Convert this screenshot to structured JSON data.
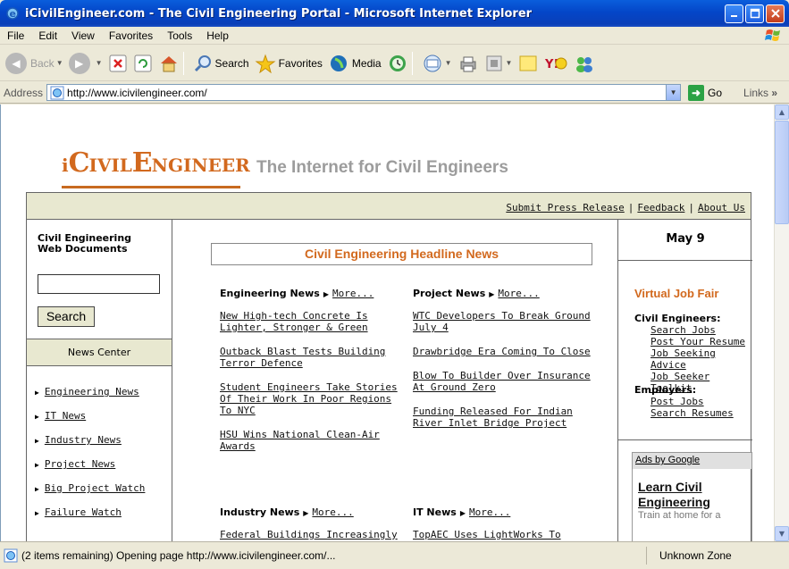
{
  "window": {
    "title": "iCivilEngineer.com - The Civil Engineering Portal - Microsoft Internet Explorer"
  },
  "menu": [
    "File",
    "Edit",
    "View",
    "Favorites",
    "Tools",
    "Help"
  ],
  "toolbar": {
    "back": "Back",
    "search": "Search",
    "favorites": "Favorites",
    "media": "Media"
  },
  "address": {
    "label": "Address",
    "url": "http://www.icivilengineer.com/",
    "go": "Go",
    "links": "Links"
  },
  "site": {
    "logo_first": "i",
    "logo_civil_c": "C",
    "logo_civil_rest": "IVIL",
    "logo_eng_e": "E",
    "logo_eng_rest": "NGINEER",
    "tagline": "The Internet for Civil Engineers",
    "nav": [
      "Submit Press Release",
      "Feedback",
      "About Us"
    ],
    "left": {
      "docs_title_1": "Civil Engineering",
      "docs_title_2": "Web Documents",
      "search_button": "Search",
      "news_center": "News Center",
      "news_links": [
        "Engineering News",
        "IT News",
        "Industry News",
        "Project News",
        "Big Project Watch",
        "Failure Watch"
      ]
    },
    "center": {
      "headline": "Civil Engineering Headline News",
      "more": "More...",
      "engineering": {
        "title": "Engineering News",
        "items": [
          "New High-tech Concrete Is Lighter, Stronger & Green",
          "Outback Blast Tests Building Terror Defence",
          "Student Engineers Take Stories Of Their Work In Poor Regions To NYC",
          "HSU Wins National Clean-Air Awards"
        ]
      },
      "project": {
        "title": "Project News",
        "items": [
          "WTC Developers To Break Ground July 4",
          "Drawbridge Era Coming To Close",
          "Blow To Builder Over Insurance At Ground Zero",
          "Funding Released For Indian River Inlet Bridge Project"
        ]
      },
      "industry": {
        "title": "Industry News",
        "items": [
          "Federal Buildings Increasingly"
        ]
      },
      "it": {
        "title": "IT News",
        "items": [
          "TopAEC Uses LightWorks To"
        ]
      }
    },
    "right": {
      "date": "May 9",
      "vjf_title": "Virtual Job Fair",
      "ce_heading": "Civil Engineers:",
      "ce_links": [
        "Search Jobs",
        "Post Your Resume",
        "Job Seeking Advice",
        "Job Seeker Toolkit"
      ],
      "emp_heading": "Employers:",
      "emp_links": [
        "Post Jobs",
        "Search Resumes"
      ],
      "ads_header": "Ads by Google",
      "ad_title": "Learn Civil Engineering",
      "ad_text": "Train at home for a"
    }
  },
  "status": {
    "text": "(2 items remaining) Opening page http://www.icivilengineer.com/...",
    "zone": "Unknown Zone"
  },
  "colors": {
    "accent_orange": "#D2691E",
    "nav_bg": "#E8E8D0",
    "titlebar_blue": "#0A5EDC"
  }
}
